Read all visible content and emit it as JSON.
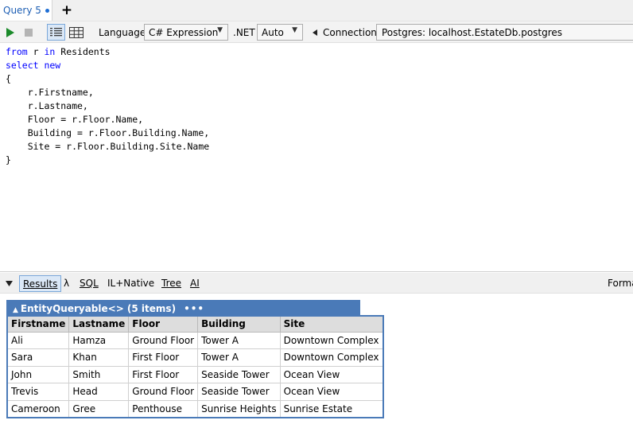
{
  "tab": {
    "label": "Query 5",
    "new_tab_label": "+"
  },
  "toolbar": {
    "language_label": "Language",
    "language_value": "C# Expression",
    "dotnet_label": ".NET",
    "dotnet_value": "Auto",
    "connection_label": "Connection",
    "connection_value": "Postgres: localhost.EstateDb.postgres"
  },
  "editor": {
    "lines": [
      "from r in Residents",
      "select new",
      "{",
      "    r.Firstname,",
      "    r.Lastname,",
      "    Floor = r.Floor.Name,",
      "    Building = r.Floor.Building.Name,",
      "    Site = r.Floor.Building.Site.Name",
      "}"
    ]
  },
  "results_bar": {
    "results": "Results",
    "lambda": "λ",
    "sql": "SQL",
    "il": "IL+Native",
    "tree": "Tree",
    "ai": "AI",
    "format": "Forma"
  },
  "results": {
    "caption": "EntityQueryable<> (5 items)",
    "columns": [
      "Firstname",
      "Lastname",
      "Floor",
      "Building",
      "Site"
    ],
    "rows": [
      [
        "Ali",
        "Hamza",
        "Ground Floor",
        "Tower A",
        "Downtown Complex"
      ],
      [
        "Sara",
        "Khan",
        "First Floor",
        "Tower A",
        "Downtown Complex"
      ],
      [
        "John",
        "Smith",
        "First Floor",
        "Seaside Tower",
        "Ocean View"
      ],
      [
        "Trevis",
        "Head",
        "Ground Floor",
        "Seaside Tower",
        "Ocean View"
      ],
      [
        "Cameroon",
        "Gree",
        "Penthouse",
        "Sunrise Heights",
        "Sunrise Estate"
      ]
    ]
  },
  "colors": {
    "accent": "#4a7ab8",
    "tab_text": "#1e5fb4",
    "keyword": "#0000ff",
    "run": "#1b8a2a"
  }
}
